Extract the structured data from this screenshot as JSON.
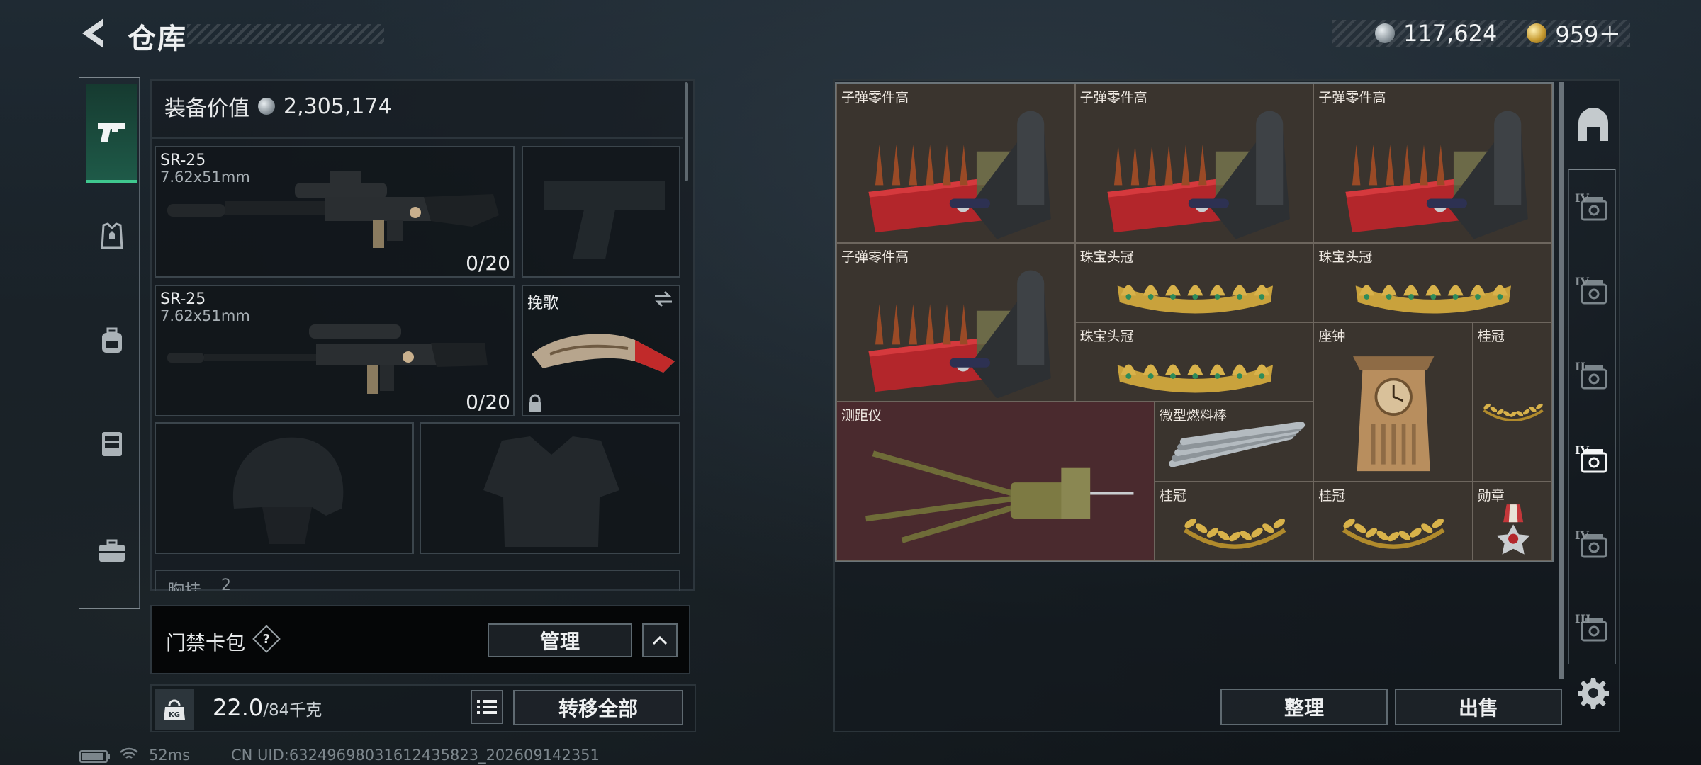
{
  "header": {
    "title": "仓库",
    "currency_silver": "117,624",
    "currency_gold": "959＋"
  },
  "loadout": {
    "equipment_value_label": "装备价值",
    "equipment_value": "2,305,174",
    "primary_weapon": {
      "name": "SR-25",
      "caliber": "7.62x51mm",
      "ammo": "0/20"
    },
    "secondary_weapon": {
      "name": "SR-25",
      "caliber": "7.62x51mm",
      "ammo": "0/20"
    },
    "melee": {
      "name": "挽歌"
    },
    "chest_rig_label": "胸挂",
    "chest_rig_count": "2"
  },
  "keycard": {
    "label": "门禁卡包",
    "help": "?",
    "manage_label": "管理"
  },
  "weight": {
    "current": "22.0",
    "max": "/84千克",
    "kg_icon_text": "KG",
    "transfer_all_label": "转移全部"
  },
  "status_bar": {
    "ping": "52ms",
    "uid": "CN UID:63249698031612435823_202609142351"
  },
  "stash": {
    "items": [
      {
        "label": "子弹零件高",
        "kind": "ammo-parts"
      },
      {
        "label": "子弹零件高",
        "kind": "ammo-parts"
      },
      {
        "label": "子弹零件高",
        "kind": "ammo-parts"
      },
      {
        "label": "子弹零件高",
        "kind": "ammo-parts"
      },
      {
        "label": "珠宝头冠",
        "kind": "tiara"
      },
      {
        "label": "珠宝头冠",
        "kind": "tiara"
      },
      {
        "label": "珠宝头冠",
        "kind": "tiara"
      },
      {
        "label": "座钟",
        "kind": "clock"
      },
      {
        "label": "桂冠",
        "kind": "laurel"
      },
      {
        "label": "测距仪",
        "kind": "rangefinder"
      },
      {
        "label": "微型燃料棒",
        "kind": "fuel-rods"
      },
      {
        "label": "桂冠",
        "kind": "laurel"
      },
      {
        "label": "桂冠",
        "kind": "laurel"
      },
      {
        "label": "勋章",
        "kind": "medal"
      }
    ],
    "sort_label": "整理",
    "sell_label": "出售"
  },
  "side_tabs": [
    {
      "level": "IV",
      "icon": "case-icon"
    },
    {
      "level": "IV",
      "icon": "safe-icon"
    },
    {
      "level": "II",
      "icon": "case-icon"
    },
    {
      "level": "IV",
      "icon": "safe-icon"
    },
    {
      "level": "IV",
      "icon": "safe-icon"
    },
    {
      "level": "III",
      "icon": "safe-icon"
    }
  ],
  "colors": {
    "accent_green": "#3fc88f",
    "grid_bg": "#3a342e",
    "grid_red": "#4a2a2e"
  }
}
